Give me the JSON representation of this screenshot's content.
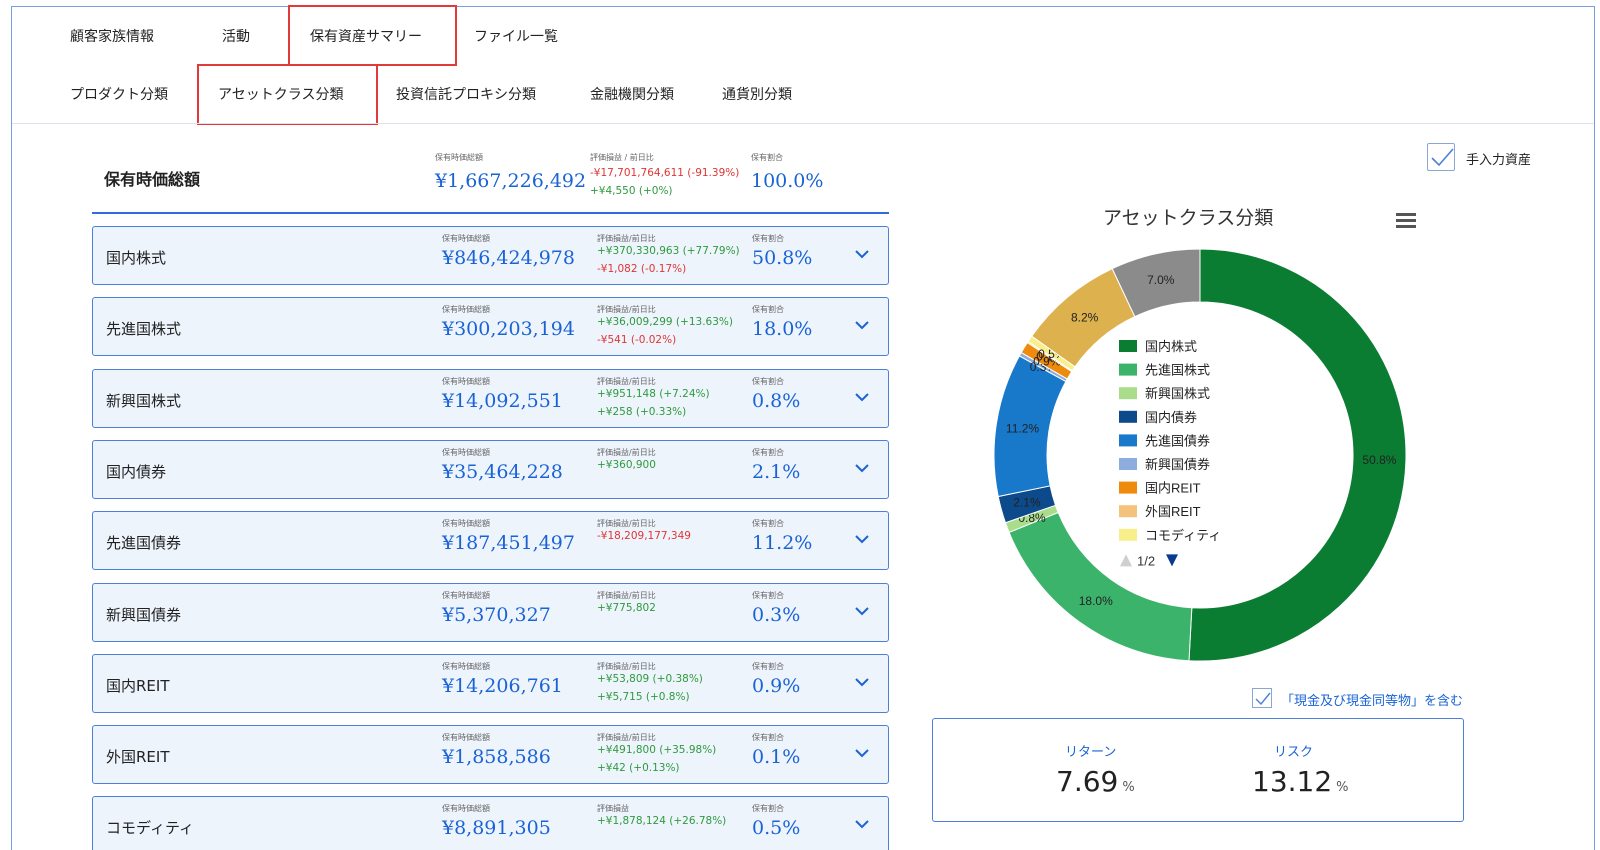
{
  "tabs_row1": [
    {
      "label": "顧客家族情報"
    },
    {
      "label": "活動"
    },
    {
      "label": "保有資産サマリー",
      "active": true
    },
    {
      "label": "ファイル一覧"
    }
  ],
  "tabs_row2": [
    {
      "label": "プロダクト分類"
    },
    {
      "label": "アセットクラス分類",
      "active": true
    },
    {
      "label": "投資信託プロキシ分類"
    },
    {
      "label": "金融機関分類"
    },
    {
      "label": "通貨別分類"
    }
  ],
  "total": {
    "label": "保有時価総額",
    "cap1": "保有時価総額",
    "value": "¥1,667,226,492",
    "cap2": "評価損益 / 前日比",
    "line1": "-¥17,701,764,611 (-91.39%)",
    "line2": "+¥4,550 (+0%)",
    "cap3": "保有割合",
    "ratio": "100.0%"
  },
  "cards": [
    {
      "label": "国内株式",
      "cap1": "保有時価総額",
      "value": "¥846,424,978",
      "cap2": "評価損益/前日比",
      "line1": "+¥370,330,963 (+77.79%)",
      "line1_sign": "pos",
      "line2": "-¥1,082 (-0.17%)",
      "line2_sign": "neg",
      "cap3": "保有割合",
      "ratio": "50.8%"
    },
    {
      "label": "先進国株式",
      "cap1": "保有時価総額",
      "value": "¥300,203,194",
      "cap2": "評価損益/前日比",
      "line1": "+¥36,009,299 (+13.63%)",
      "line1_sign": "pos",
      "line2": "-¥541 (-0.02%)",
      "line2_sign": "neg",
      "cap3": "保有割合",
      "ratio": "18.0%"
    },
    {
      "label": "新興国株式",
      "cap1": "保有時価総額",
      "value": "¥14,092,551",
      "cap2": "評価損益/前日比",
      "line1": "+¥951,148 (+7.24%)",
      "line1_sign": "pos",
      "line2": "+¥258 (+0.33%)",
      "line2_sign": "pos",
      "cap3": "保有割合",
      "ratio": "0.8%"
    },
    {
      "label": "国内債券",
      "cap1": "保有時価総額",
      "value": "¥35,464,228",
      "cap2": "評価損益/前日比",
      "line1": "+¥360,900",
      "line1_sign": "pos",
      "line2": "",
      "line2_sign": "pos",
      "cap3": "保有割合",
      "ratio": "2.1%"
    },
    {
      "label": "先進国債券",
      "cap1": "保有時価総額",
      "value": "¥187,451,497",
      "cap2": "評価損益/前日比",
      "line1": "-¥18,209,177,349",
      "line1_sign": "neg",
      "line2": "",
      "line2_sign": "pos",
      "cap3": "保有割合",
      "ratio": "11.2%"
    },
    {
      "label": "新興国債券",
      "cap1": "保有時価総額",
      "value": "¥5,370,327",
      "cap2": "評価損益/前日比",
      "line1": "+¥775,802",
      "line1_sign": "pos",
      "line2": "",
      "line2_sign": "pos",
      "cap3": "保有割合",
      "ratio": "0.3%"
    },
    {
      "label": "国内REIT",
      "cap1": "保有時価総額",
      "value": "¥14,206,761",
      "cap2": "評価損益/前日比",
      "line1": "+¥53,809 (+0.38%)",
      "line1_sign": "pos",
      "line2": "+¥5,715 (+0.8%)",
      "line2_sign": "pos",
      "cap3": "保有割合",
      "ratio": "0.9%"
    },
    {
      "label": "外国REIT",
      "cap1": "保有時価総額",
      "value": "¥1,858,586",
      "cap2": "評価損益/前日比",
      "line1": "+¥491,800 (+35.98%)",
      "line1_sign": "pos",
      "line2": "+¥42 (+0.13%)",
      "line2_sign": "pos",
      "cap3": "保有割合",
      "ratio": "0.1%"
    },
    {
      "label": "コモディティ",
      "cap1": "保有時価総額",
      "value": "¥8,891,305",
      "cap2": "評価損益",
      "line1": "+¥1,878,124 (+26.78%)",
      "line1_sign": "pos",
      "line2": "",
      "line2_sign": "pos",
      "cap3": "保有割合",
      "ratio": "0.5%"
    }
  ],
  "manual_assets": {
    "label": "手入力資産",
    "checked": true
  },
  "chart_title": "アセットクラス分類",
  "chart_data": {
    "type": "pie",
    "title": "アセットクラス分類",
    "hole": true,
    "legend_page": "1/2",
    "legend_position": "center",
    "slices": [
      {
        "name": "国内株式",
        "value": 50.8,
        "label": "50.8%",
        "color": "#0a7d33"
      },
      {
        "name": "先進国株式",
        "value": 18.0,
        "label": "18.0%",
        "color": "#3cb36b"
      },
      {
        "name": "新興国株式",
        "value": 0.8,
        "label": "0.8%",
        "color": "#a9dd8c"
      },
      {
        "name": "国内債券",
        "value": 2.1,
        "label": "2.1%",
        "color": "#0d4a8c"
      },
      {
        "name": "先進国債券",
        "value": 11.2,
        "label": "11.2%",
        "color": "#1878c9"
      },
      {
        "name": "新興国債券",
        "value": 0.3,
        "label": "0.3%",
        "color": "#8cadde"
      },
      {
        "name": "国内REIT",
        "value": 0.9,
        "label": "0.9%",
        "color": "#ee8b0c"
      },
      {
        "name": "外国REIT",
        "value": 0.1,
        "label": "0.1%",
        "color": "#f5c27b"
      },
      {
        "name": "コモディティ",
        "value": 0.5,
        "label": "0.5%",
        "color": "#f9ef8a"
      },
      {
        "name": "",
        "value": 8.2,
        "label": "8.2%",
        "color": "#ddb24e"
      },
      {
        "name": "",
        "value": 7.0,
        "label": "7.0%",
        "color": "#8b8b8b"
      }
    ]
  },
  "cash_option": {
    "label": "「現金及び現金同等物」を含む",
    "checked": true
  },
  "return_risk": {
    "return_label": "リターン",
    "return_value": "7.69",
    "return_unit": "%",
    "risk_label": "リスク",
    "risk_value": "13.12",
    "risk_unit": "%"
  }
}
